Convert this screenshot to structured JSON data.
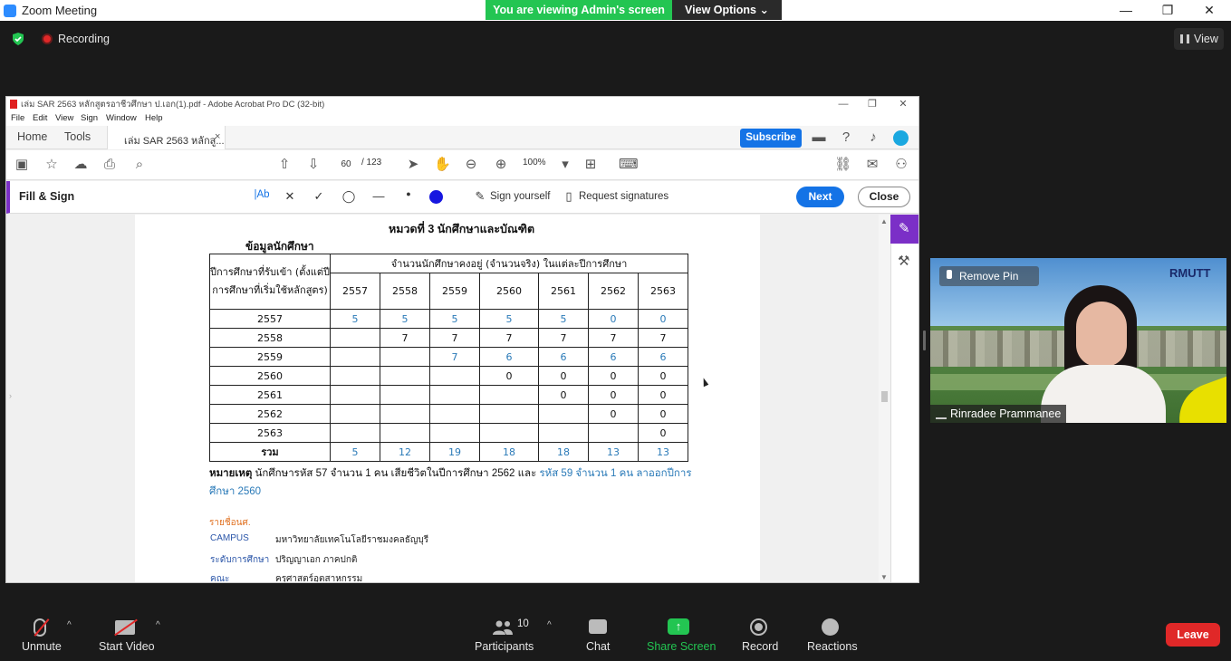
{
  "zoom": {
    "window_title": "Zoom Meeting",
    "banner": "You are viewing Admin's screen",
    "view_options": "View Options",
    "recording_label": "Recording",
    "view_button": "View",
    "window_controls": {
      "minimize": "—",
      "maximize": "❐",
      "close": "✕"
    }
  },
  "acrobat": {
    "window_title": "เล่ม SAR 2563 หลักสูตรอาชีวศึกษา ป.เอก(1).pdf - Adobe Acrobat Pro DC (32-bit)",
    "window_controls": {
      "minimize": "—",
      "maximize": "❐",
      "close": "✕"
    },
    "menu": [
      "File",
      "Edit",
      "View",
      "Sign",
      "Window",
      "Help"
    ],
    "tabs": {
      "home": "Home",
      "tools": "Tools",
      "document": "เล่ม SAR 2563 หลักสู...",
      "close": "×"
    },
    "subscribe": "Subscribe",
    "page_current": "60",
    "page_total": "/ 123",
    "zoom_level": "100%",
    "fill_sign": {
      "title": "Fill & Sign",
      "text_tool": "|Ab",
      "sign_yourself": "Sign yourself",
      "request_signatures": "Request signatures",
      "next": "Next",
      "close": "Close",
      "color_blue": "#1717e0"
    },
    "document": {
      "heading": "หมวดที่ 3 นักศึกษาและบัณฑิต",
      "subheading": "ข้อมูลนักศึกษา",
      "table": {
        "row_header": "ปีการศึกษาที่รับเข้า (ตั้งแต่ปีการศึกษาที่เริ่มใช้หลักสูตร)",
        "group_header": "จำนวนนักศึกษาคงอยู่ (จำนวนจริง) ในแต่ละปีการศึกษา",
        "years": [
          "2557",
          "2558",
          "2559",
          "2560",
          "2561",
          "2562",
          "2563"
        ],
        "rows": [
          {
            "label": "2557",
            "cells": [
              "5",
              "5",
              "5",
              "5",
              "5",
              "0",
              "0"
            ]
          },
          {
            "label": "2558",
            "cells": [
              "",
              "7",
              "7",
              "7",
              "7",
              "7",
              "7"
            ]
          },
          {
            "label": "2559",
            "cells": [
              "",
              "",
              "7",
              "6",
              "6",
              "6",
              "6"
            ]
          },
          {
            "label": "2560",
            "cells": [
              "",
              "",
              "",
              "0",
              "0",
              "0",
              "0"
            ]
          },
          {
            "label": "2561",
            "cells": [
              "",
              "",
              "",
              "",
              "0",
              "0",
              "0"
            ]
          },
          {
            "label": "2562",
            "cells": [
              "",
              "",
              "",
              "",
              "",
              "0",
              "0"
            ]
          },
          {
            "label": "2563",
            "cells": [
              "",
              "",
              "",
              "",
              "",
              "",
              "0"
            ]
          }
        ],
        "total_label": "รวม",
        "totals": [
          "5",
          "12",
          "19",
          "18",
          "18",
          "13",
          "13"
        ]
      },
      "note_label": "หมายเหตุ",
      "note_text_black": "นักศึกษารหัส 57 จำนวน 1 คน เสียชีวิตในปีการศึกษา 2562 และ",
      "note_text_blue": "รหัส 59 จำนวน 1 คน ลาออกปีการศึกษา 2560",
      "info_title": "รายชื่อนศ.",
      "info": [
        {
          "key": "CAMPUS",
          "value": "มหาวิทยาลัยเทคโนโลยีราชมงคลธัญบุรี"
        },
        {
          "key": "ระดับการศึกษา",
          "value": "ปริญญาเอก ภาคปกติ"
        },
        {
          "key": "คณะ",
          "value": "ครุศาสตร์อุตสาหกรรม"
        }
      ]
    }
  },
  "video": {
    "remove_pin": "Remove Pin",
    "participant_name": "Rinradee Prammanee",
    "logo": "RMUTT"
  },
  "bottom_bar": {
    "unmute": "Unmute",
    "start_video": "Start Video",
    "participants": "Participants",
    "participants_count": "10",
    "chat": "Chat",
    "share_screen": "Share Screen",
    "share_symbol": "↑",
    "record": "Record",
    "reactions": "Reactions",
    "leave": "Leave",
    "caret": "^"
  },
  "colors": {
    "banner_green": "#23c552",
    "acrobat_blue": "#1473e6",
    "fill_sign_purple": "#7b2fc7",
    "leave_red": "#e02828",
    "table_blue_text": "#2a7ab8"
  }
}
